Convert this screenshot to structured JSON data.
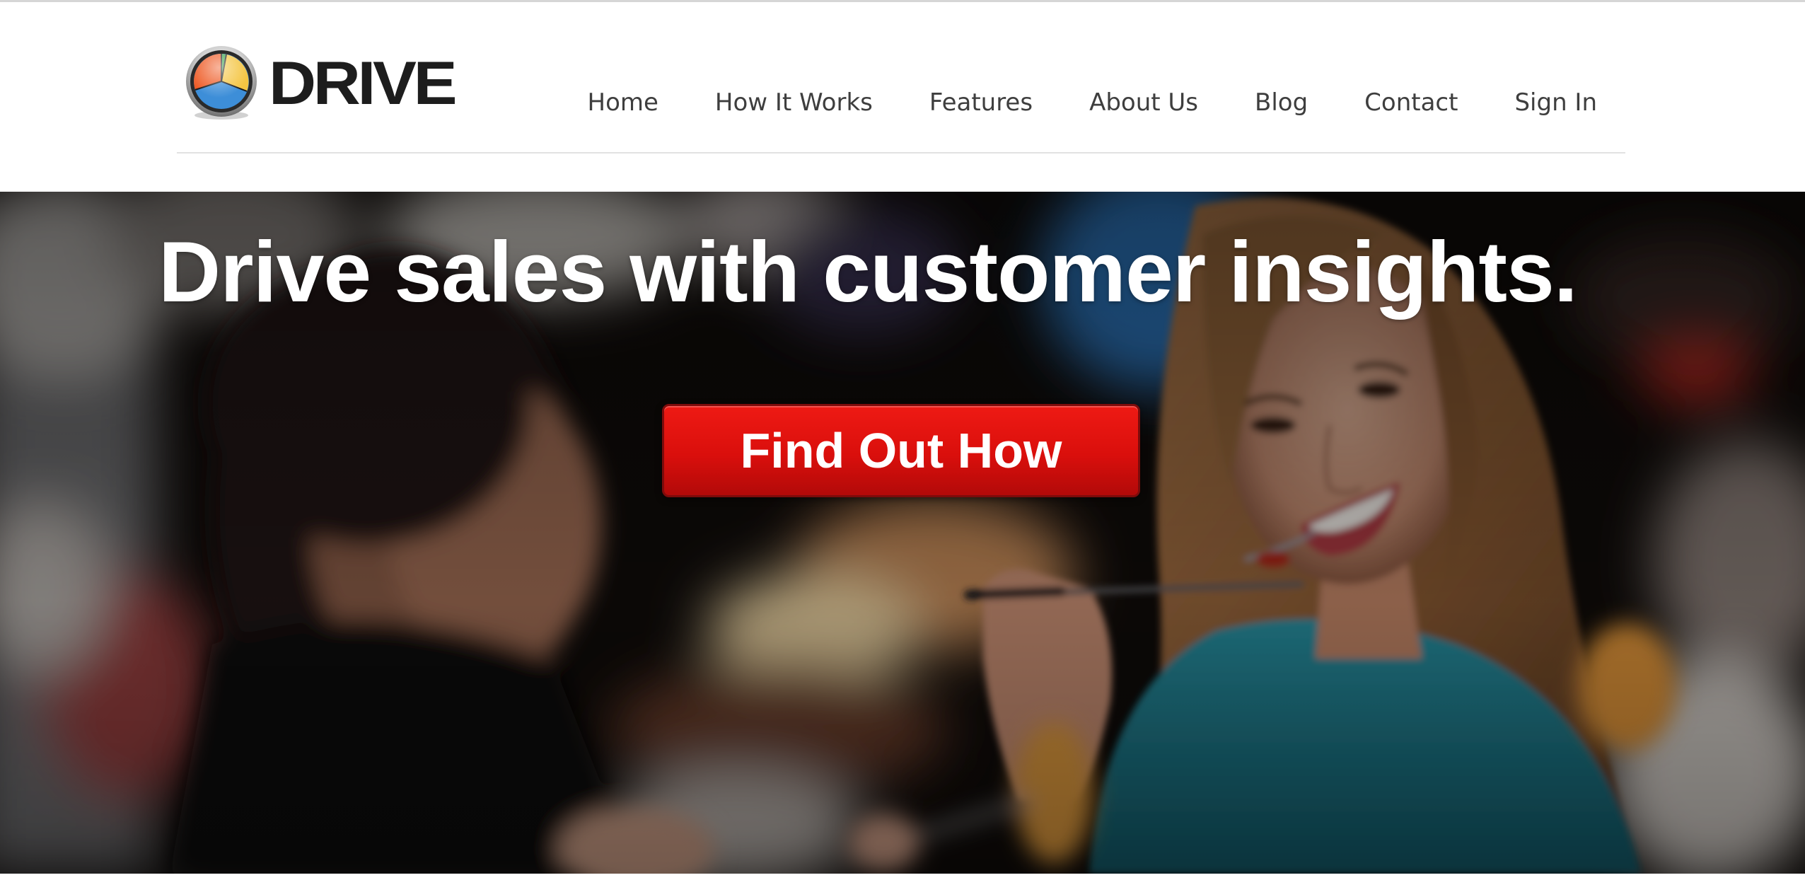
{
  "brand": {
    "name": "DRIVE",
    "logo_icon": "pie-chart-logo-icon",
    "colors": {
      "slice_orange": "#ee5a24",
      "slice_yellow": "#f4c542",
      "slice_blue": "#3d8ed8",
      "slice_green": "#3aa64c",
      "ring": "#d9d9d9",
      "text": "#1d1d1d"
    }
  },
  "nav": {
    "items": [
      {
        "label": "Home"
      },
      {
        "label": "How It Works"
      },
      {
        "label": "Features"
      },
      {
        "label": "About Us"
      },
      {
        "label": "Blog"
      },
      {
        "label": "Contact"
      },
      {
        "label": "Sign In"
      }
    ],
    "color": "#3e3e3e"
  },
  "hero": {
    "headline": "Drive sales with customer insights.",
    "cta_label": "Find Out How",
    "cta_color": "#da0f0c",
    "background_description_colors": {
      "dark": "#0d0a08",
      "teal_top": "#1f7f92",
      "skin": "#c98f73",
      "hair": "#9a6a3e"
    }
  }
}
